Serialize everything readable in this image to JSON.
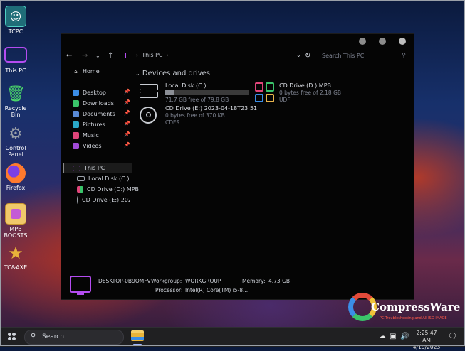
{
  "desktop": {
    "icons": [
      {
        "label": "TCPC",
        "icon": "user-circle-icon",
        "color": "#4fd1c5"
      },
      {
        "label": "This PC",
        "icon": "monitor-icon",
        "color": "#b44cf0"
      },
      {
        "label": "Recycle Bin",
        "icon": "recycle-bin-icon",
        "color": "#4ad46a"
      },
      {
        "label": "Control Panel",
        "icon": "gear-icon",
        "color": "#8a9099"
      },
      {
        "label": "Firefox",
        "icon": "firefox-icon",
        "color": "#ff7a2e"
      },
      {
        "label": "MPB BOOSTS",
        "icon": "mpb-icon",
        "color": "#e9b44c"
      },
      {
        "label": "TC&AXE",
        "icon": "star-icon",
        "color": "#e8b23a"
      }
    ]
  },
  "explorer": {
    "breadcrumb": "This PC",
    "search_placeholder": "Search This PC",
    "sidebar": {
      "home": "Home",
      "quick": [
        {
          "label": "Desktop",
          "color": "#3b8ee8"
        },
        {
          "label": "Downloads",
          "color": "#3ac46a"
        },
        {
          "label": "Documents",
          "color": "#5a8bd6"
        },
        {
          "label": "Pictures",
          "color": "#2aa8c8"
        },
        {
          "label": "Music",
          "color": "#e0457a"
        },
        {
          "label": "Videos",
          "color": "#a04ad6"
        }
      ],
      "this_pc": "This PC",
      "drives": [
        "Local Disk (C:)",
        "CD Drive (D:) MPB",
        "CD Drive (E:) 2023-0"
      ]
    },
    "section_title": "Devices and drives",
    "devices": [
      {
        "name": "Local Disk (C:)",
        "sub": "71.7 GB free of 79.8 GB",
        "used_fraction": 0.1
      },
      {
        "name": "CD Drive (D:) MPB",
        "sub": "0 bytes free of 2.18 GB",
        "sub2": "UDF"
      },
      {
        "name": "CD Drive (E:) 2023-04-18T23:51",
        "sub": "0 bytes free of 370 KB",
        "sub2": "CDFS"
      }
    ],
    "details": {
      "computer_name": "DESKTOP-0B9OMFV",
      "workgroup_label": "Workgroup:",
      "workgroup_value": "WORKGROUP",
      "memory_label": "Memory:",
      "memory_value": "4.73 GB",
      "processor_label": "Processor:",
      "processor_value": "Intel(R) Core(TM) i5-8..."
    }
  },
  "watermark": {
    "brand": "CompressWare",
    "tagline": "PC Troubleshooting and All ISO IMAGE"
  },
  "taskbar": {
    "search_label": "Search",
    "time": "2:25:47 AM",
    "date": "4/19/2023"
  }
}
